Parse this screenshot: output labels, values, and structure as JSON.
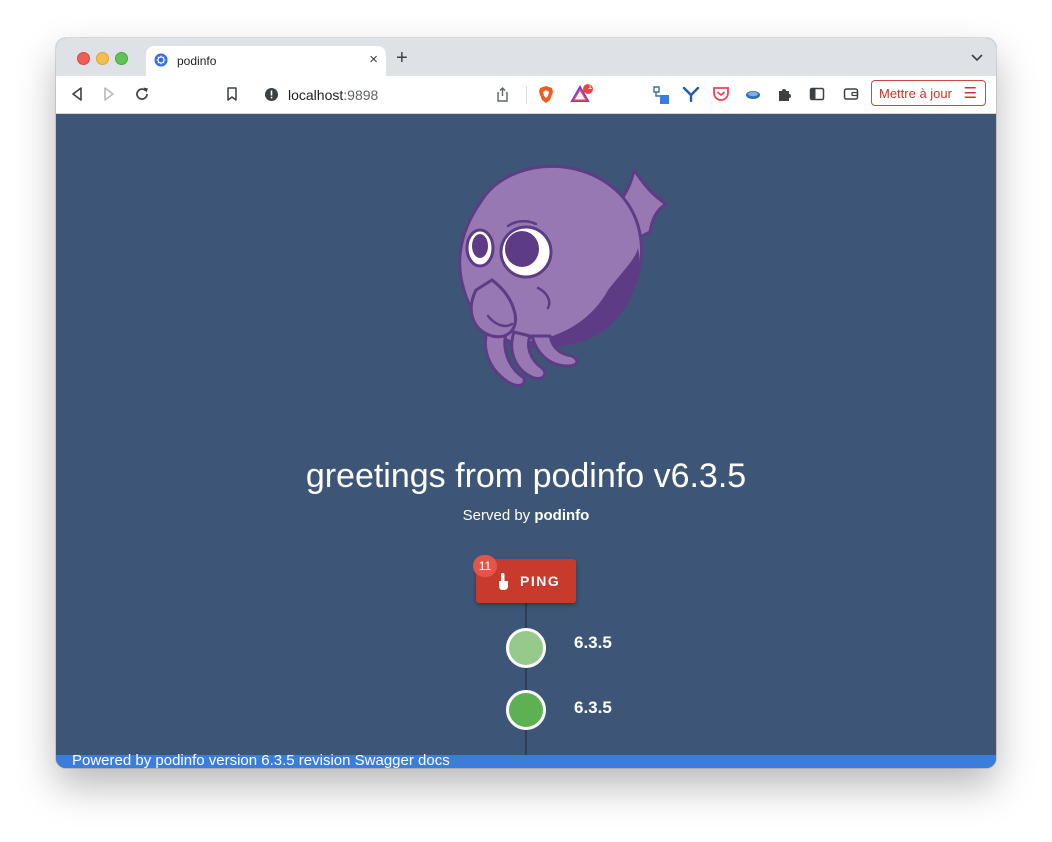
{
  "browser": {
    "tab_title": "podinfo",
    "tab_close": "×",
    "new_tab": "+",
    "url_host": "localhost",
    "url_port": ":9898",
    "update_button_label": "Mettre à jour",
    "update_button_menu": "☰",
    "brave_badge_count": "1",
    "icons": [
      "back-icon",
      "forward-icon",
      "reload-icon",
      "bookmark-icon",
      "site-info-icon",
      "share-icon",
      "brave-shields-icon",
      "brave-rewards-icon",
      "extension-icon",
      "extension-icon",
      "pocket-icon",
      "extension-icon",
      "extensions-puzzle-icon",
      "sidebar-icon",
      "wallet-icon"
    ]
  },
  "page": {
    "greeting": "greetings from podinfo v6.3.5",
    "served_prefix": "Served by ",
    "served_name": "podinfo",
    "ping_label": "PING",
    "ping_count": "11",
    "timeline": [
      {
        "label": "6.3.5",
        "color": "#96c98a"
      },
      {
        "label": "6.3.5",
        "color": "#5db153"
      }
    ],
    "footer_text": "Powered by podinfo version 6.3.5 revision Swagger docs"
  },
  "colors": {
    "page_background": "#3d5677",
    "ping_button": "#c73a2c",
    "badge": "#e0574a",
    "footer_bar": "#3b7ddb",
    "mascot_body": "#9878b3",
    "mascot_dark": "#5d3c85"
  }
}
